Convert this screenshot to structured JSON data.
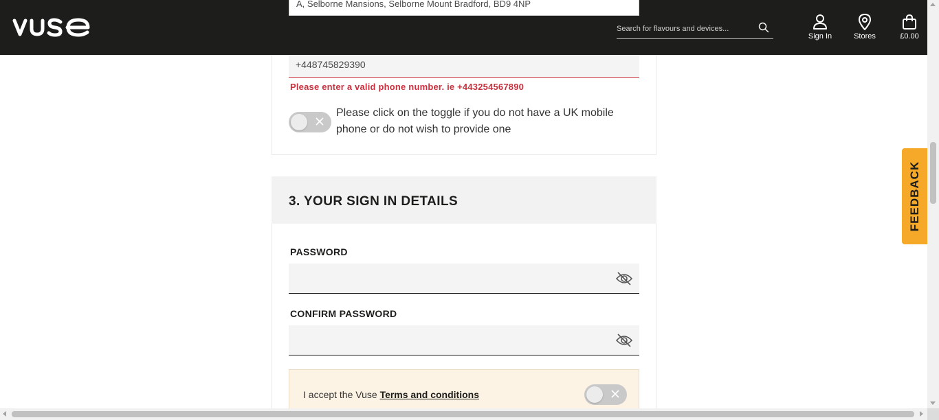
{
  "header": {
    "logo_text": "vuse",
    "search": {
      "placeholder": "Search for flavours and devices..."
    },
    "nav": {
      "sign_in": "Sign In",
      "stores": "Stores",
      "basket": "£0.00"
    }
  },
  "address_suggestion": "A, Selborne Mansions, Selborne Mount Bradford, BD9 4NP",
  "phone": {
    "value": "+448745829390",
    "error": "Please enter a valid phone number. ie +443254567890",
    "toggle_label": "Please click on the toggle if you do not have a UK mobile phone or do not wish to provide one"
  },
  "sign_in_section": {
    "title": "3. YOUR SIGN IN DETAILS",
    "password_label": "PASSWORD",
    "confirm_password_label": "CONFIRM PASSWORD"
  },
  "terms": {
    "prefix": "I accept the Vuse ",
    "link": "Terms and conditions"
  },
  "feedback": {
    "label": "FEEDBACK"
  },
  "colors": {
    "header_bg": "#1d1d1b",
    "error": "#c8313e",
    "feedback_bg": "#f6a928",
    "terms_bg": "#fdf3e4"
  }
}
